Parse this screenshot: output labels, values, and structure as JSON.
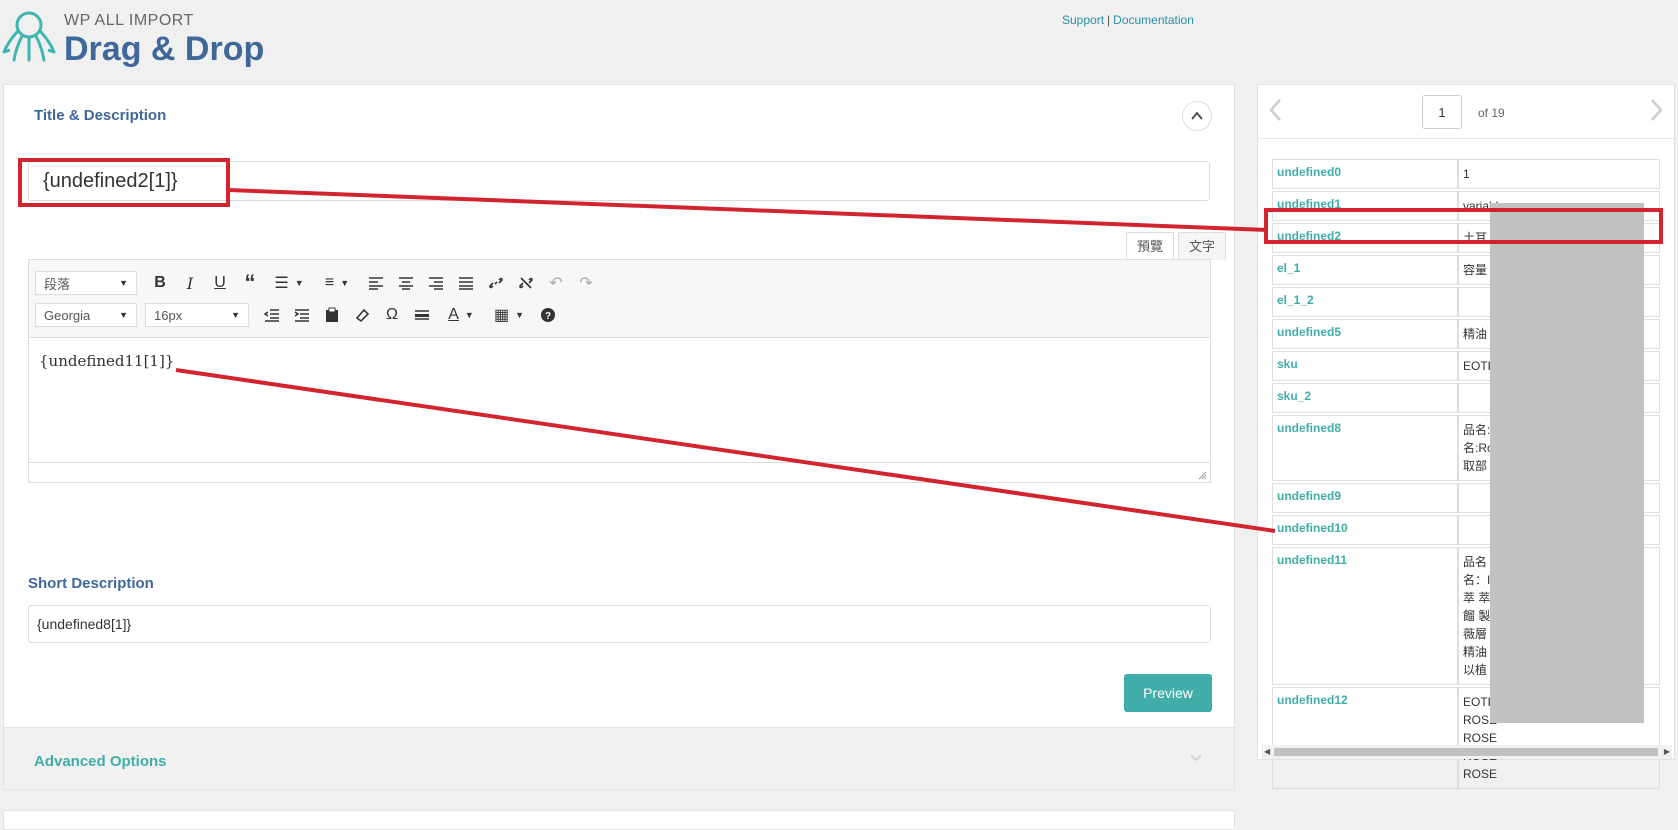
{
  "header": {
    "brand_small": "WP ALL IMPORT",
    "brand_big": "Drag & Drop",
    "links": {
      "support": "Support",
      "separator": "|",
      "documentation": "Documentation"
    }
  },
  "title_section": {
    "title": "Title & Description",
    "title_input_value": "{undefined2[1]}",
    "tabs": {
      "visual": "預覽",
      "text": "文字"
    },
    "toolbar": {
      "format_select": "段落",
      "font_select": "Georgia",
      "size_select": "16px"
    },
    "content_value": "{undefined11[1]}"
  },
  "short_description": {
    "title": "Short Description",
    "input_value": "{undefined8[1]}"
  },
  "preview_button": "Preview",
  "advanced_options": {
    "title": "Advanced Options"
  },
  "record_nav": {
    "current_page": "1",
    "of_label": "of 19"
  },
  "record_fields": [
    {
      "key": "undefined0",
      "value": [
        "1"
      ]
    },
    {
      "key": "undefined1",
      "value": [
        "variable"
      ]
    },
    {
      "key": "undefined2",
      "value": [
        "土耳"
      ]
    },
    {
      "key": "el_1",
      "value": [
        "容量"
      ]
    },
    {
      "key": "el_1_2",
      "value": [
        ""
      ]
    },
    {
      "key": "undefined5",
      "value": [
        "精油"
      ]
    },
    {
      "key": "sku",
      "value": [
        "EOTK"
      ]
    },
    {
      "key": "sku_2",
      "value": [
        ""
      ]
    },
    {
      "key": "undefined8",
      "value": [
        "品名:",
        "名:Ro",
        "取部"
      ]
    },
    {
      "key": "undefined9",
      "value": [
        ""
      ]
    },
    {
      "key": "undefined10",
      "value": [
        ""
      ]
    },
    {
      "key": "undefined11",
      "value": [
        "品名",
        "名：I",
        "萃 萃",
        "餾 製",
        "薇層",
        "精油",
        "以植"
      ]
    },
    {
      "key": "undefined12",
      "value": [
        "EOTK",
        "ROSE",
        "ROSE",
        "ROSE",
        "ROSE"
      ]
    }
  ],
  "colors": {
    "accent_teal": "#40ada8",
    "brand_blue": "#40679a",
    "annotation_red": "#d1242f"
  },
  "icons": [
    "octopus-logo-icon",
    "chevron-up-icon",
    "chevron-down-icon",
    "chevron-left-icon",
    "chevron-right-icon",
    "bold-icon",
    "italic-icon",
    "underline-icon",
    "blockquote-icon",
    "bullet-list-icon",
    "numbered-list-icon",
    "align-left-icon",
    "align-center-icon",
    "align-right-icon",
    "justify-icon",
    "link-icon",
    "unlink-icon",
    "undo-icon",
    "redo-icon",
    "outdent-icon",
    "indent-icon",
    "paste-icon",
    "eraser-icon",
    "omega-icon",
    "horizontal-rule-icon",
    "text-color-icon",
    "table-icon",
    "help-icon"
  ]
}
